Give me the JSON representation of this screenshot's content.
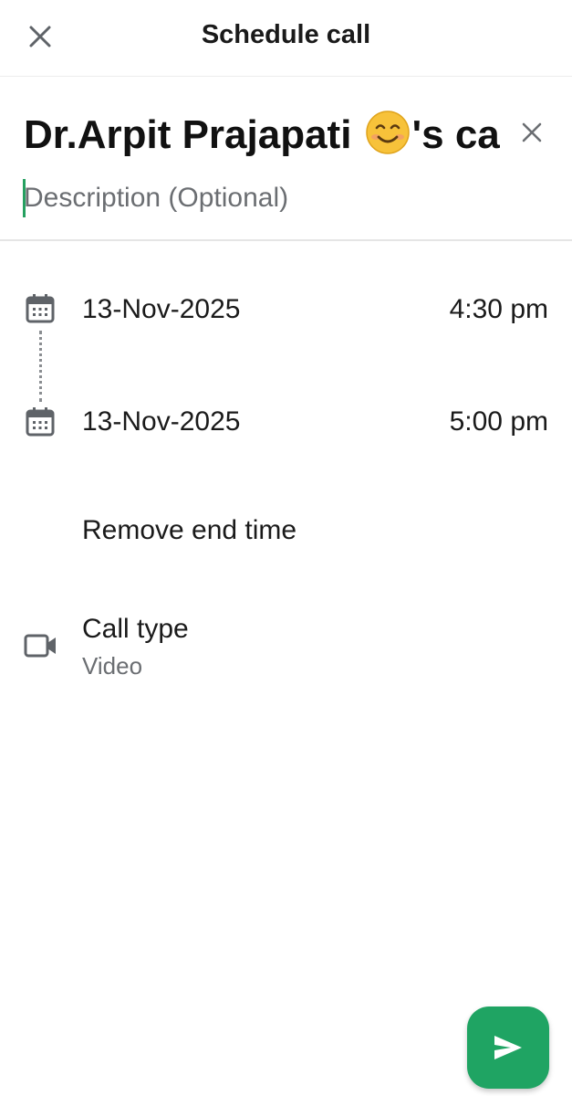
{
  "header": {
    "title": "Schedule call"
  },
  "call": {
    "title_prefix": "Dr.Arpit Prajapati",
    "title_suffix": "'s ca",
    "description_placeholder": "Description (Optional)"
  },
  "schedule": {
    "start_date": "13-Nov-2025",
    "start_time": "4:30 pm",
    "end_date": "13-Nov-2025",
    "end_time": "5:00 pm",
    "remove_end_label": "Remove end time"
  },
  "call_type": {
    "label": "Call type",
    "value": "Video"
  },
  "colors": {
    "accent": "#1fa463",
    "cursor": "#25a060",
    "icon": "#5f6368",
    "secondary_text": "#6b6e72"
  },
  "icons": {
    "close": "close-icon",
    "clear": "clear-icon",
    "calendar": "calendar-icon",
    "video": "video-camera-icon",
    "send": "send-icon"
  }
}
